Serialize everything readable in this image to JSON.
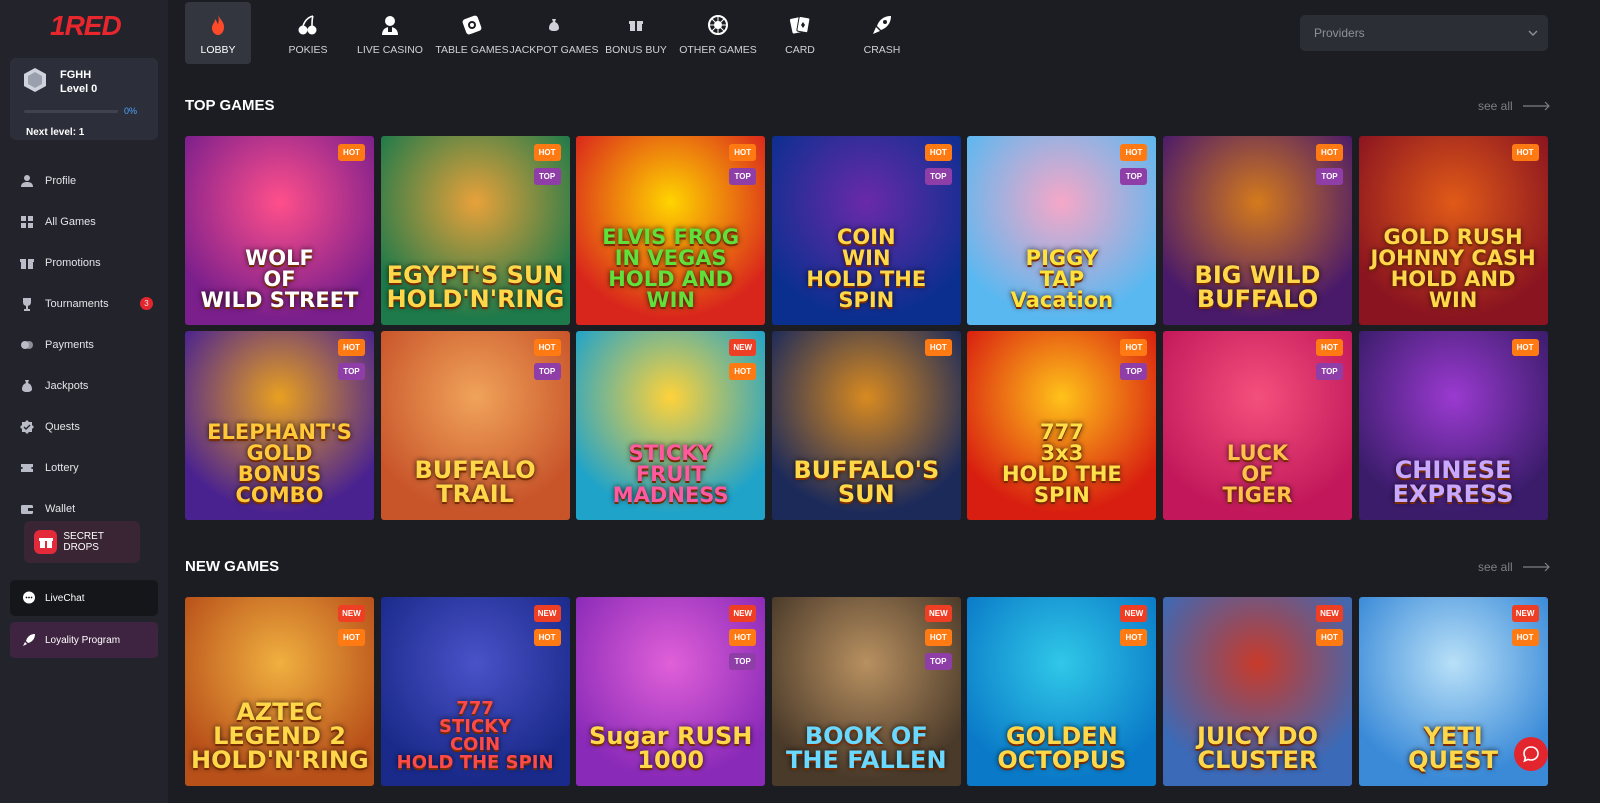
{
  "brand": {
    "logo": "1RED"
  },
  "user": {
    "name": "FGHH",
    "level": "Level 0",
    "progress_percent": 0,
    "progress_text": "0%",
    "next_level": "Next level: 1"
  },
  "menu": [
    {
      "label": "Profile",
      "icon": "user-icon",
      "name": "menu-profile"
    },
    {
      "label": "All Games",
      "icon": "grid-icon",
      "name": "menu-all-games"
    },
    {
      "label": "Promotions",
      "icon": "gift-icon",
      "name": "menu-promotions"
    },
    {
      "label": "Tournaments",
      "icon": "trophy-icon",
      "name": "menu-tournaments",
      "badge": "3"
    },
    {
      "label": "Payments",
      "icon": "coins-icon",
      "name": "menu-payments"
    },
    {
      "label": "Jackpots",
      "icon": "money-bag-icon",
      "name": "menu-jackpots"
    },
    {
      "label": "Quests",
      "icon": "badge-check-icon",
      "name": "menu-quests"
    },
    {
      "label": "Lottery",
      "icon": "ticket-icon",
      "name": "menu-lottery"
    },
    {
      "label": "Wallet",
      "icon": "wallet-icon",
      "name": "menu-wallet"
    }
  ],
  "secret_drops": {
    "label": "SECRET DROPS",
    "icon": "gift-box-icon"
  },
  "livechat": {
    "label": "LiveChat",
    "icon": "chat-bubble-icon"
  },
  "loyalty": {
    "label": "Loyality Program",
    "icon": "rocket-icon"
  },
  "tabs": [
    {
      "label": "LOBBY",
      "icon": "flame-icon",
      "active": true
    },
    {
      "label": "POKIES",
      "icon": "cherries-icon"
    },
    {
      "label": "LIVE CASINO",
      "icon": "dealer-icon"
    },
    {
      "label": "TABLE GAMES",
      "icon": "roulette-ticket-icon"
    },
    {
      "label": "JACKPOT GAMES",
      "icon": "money-bag-icon"
    },
    {
      "label": "BONUS BUY",
      "icon": "gift-icon"
    },
    {
      "label": "OTHER GAMES",
      "icon": "roulette-wheel-icon"
    },
    {
      "label": "CARD",
      "icon": "playing-cards-icon"
    },
    {
      "label": "CRASH",
      "icon": "rocket-icon"
    }
  ],
  "providers": {
    "placeholder": "Providers"
  },
  "sections": {
    "top": {
      "title": "TOP GAMES",
      "see_all": "see all"
    },
    "new": {
      "title": "NEW GAMES",
      "see_all": "see all"
    }
  },
  "top_games": [
    {
      "title": "WOLF\nOF\nWILD STREET",
      "tags": [
        "HOT"
      ],
      "c1": "#7b1f8c",
      "c2": "#ff4f8b",
      "fg": "#ffffff"
    },
    {
      "title": "EGYPT'S SUN\nHOLD'N'RING",
      "tags": [
        "HOT",
        "TOP"
      ],
      "c1": "#1e7a4a",
      "c2": "#e8a13a",
      "fg": "#ffd84a"
    },
    {
      "title": "ELVIS FROG\nIN VEGAS\nHOLD AND WIN",
      "tags": [
        "HOT",
        "TOP"
      ],
      "c1": "#d9261c",
      "c2": "#ffd400",
      "fg": "#5fe03a"
    },
    {
      "title": "COIN\nWIN\nHOLD THE SPIN",
      "tags": [
        "HOT",
        "TOP"
      ],
      "c1": "#0b2f8f",
      "c2": "#6a2aa8",
      "fg": "#ffd84a"
    },
    {
      "title": "PIGGY\nTAP\nVacation",
      "tags": [
        "HOT",
        "TOP"
      ],
      "c1": "#5ab8f0",
      "c2": "#f6a7c8",
      "fg": "#ffe23a"
    },
    {
      "title": "BIG WILD\nBUFFALO",
      "tags": [
        "HOT",
        "TOP"
      ],
      "c1": "#4a1a6a",
      "c2": "#d47a1c",
      "fg": "#ffd84a"
    },
    {
      "title": "GOLD RUSH\nJOHNNY CASH\nHOLD AND WIN",
      "tags": [
        "HOT"
      ],
      "c1": "#8a1420",
      "c2": "#e05a18",
      "fg": "#ffd84a"
    },
    {
      "title": "ELEPHANT'S\nGOLD\nBONUS COMBO",
      "tags": [
        "HOT",
        "TOP"
      ],
      "c1": "#4a2290",
      "c2": "#e8a020",
      "fg": "#ffc93a"
    },
    {
      "title": "BUFFALO TRAIL",
      "tags": [
        "HOT",
        "TOP"
      ],
      "c1": "#c8542a",
      "c2": "#f0a35a",
      "fg": "#ffd84a"
    },
    {
      "title": "STICKY\nFRUIT\nMADNESS",
      "tags": [
        "NEW",
        "HOT"
      ],
      "c1": "#1fa3c9",
      "c2": "#ffd23a",
      "fg": "#ff5aa0"
    },
    {
      "title": "BUFFALO'S\nSUN",
      "tags": [
        "HOT"
      ],
      "c1": "#1c2a5a",
      "c2": "#d88a20",
      "fg": "#ffd84a"
    },
    {
      "title": "777\n3x3\nHOLD THE SPIN",
      "tags": [
        "HOT",
        "TOP"
      ],
      "c1": "#d81e10",
      "c2": "#ffc21a",
      "fg": "#ffe04a"
    },
    {
      "title": "LUCK\nOF\nTIGER",
      "tags": [
        "HOT",
        "TOP"
      ],
      "c1": "#c2185b",
      "c2": "#f4507c",
      "fg": "#ffc14a"
    },
    {
      "title": "CHINESE\nEXPRESS",
      "tags": [
        "HOT"
      ],
      "c1": "#3a1c6a",
      "c2": "#9a3ad0",
      "fg": "#c9a8ff"
    }
  ],
  "new_games": [
    {
      "title": "AZTEC LEGEND 2\nHOLD'N'RING",
      "tags": [
        "NEW",
        "HOT"
      ],
      "c1": "#b8501a",
      "c2": "#f0b040",
      "fg": "#ffd84a"
    },
    {
      "title": "777\nSTICKY\nCOIN\nHOLD THE SPIN",
      "tags": [
        "NEW",
        "HOT"
      ],
      "c1": "#1a2a8a",
      "c2": "#4a52c8",
      "fg": "#ff4a4a"
    },
    {
      "title": "Sugar RUSH\n1000",
      "tags": [
        "NEW",
        "HOT",
        "TOP"
      ],
      "c1": "#8a2ab8",
      "c2": "#e060d8",
      "fg": "#ffd84a"
    },
    {
      "title": "BOOK OF\nTHE FALLEN",
      "tags": [
        "NEW",
        "HOT",
        "TOP"
      ],
      "c1": "#4a3a2a",
      "c2": "#b89060",
      "fg": "#6ad8ff"
    },
    {
      "title": "GOLDEN\nOCTOPUS",
      "tags": [
        "NEW",
        "HOT"
      ],
      "c1": "#0a7ac8",
      "c2": "#30c8e8",
      "fg": "#ffd84a"
    },
    {
      "title": "JUICY DO\nCLUSTER",
      "tags": [
        "NEW",
        "HOT"
      ],
      "c1": "#3a6ab8",
      "c2": "#c83a2a",
      "fg": "#ffd84a"
    },
    {
      "title": "YETI\nQUEST",
      "tags": [
        "NEW",
        "HOT"
      ],
      "c1": "#3a8ad8",
      "c2": "#b8e0f8",
      "fg": "#ffd84a"
    }
  ]
}
